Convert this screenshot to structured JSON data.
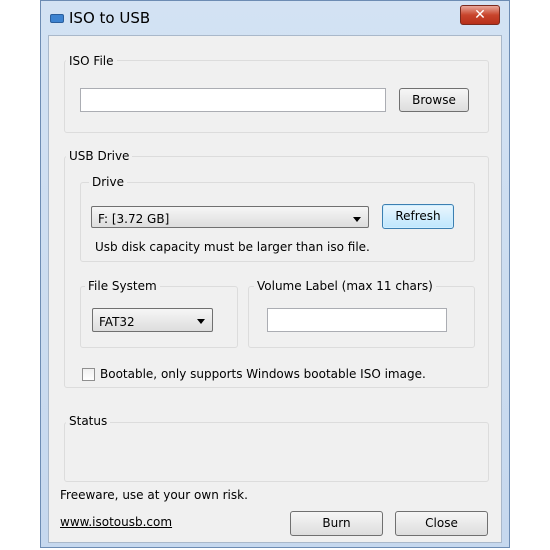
{
  "window": {
    "title": "ISO to USB",
    "close_glyph": "✕"
  },
  "iso_file": {
    "legend": "ISO File",
    "path_value": "",
    "browse_label": "Browse"
  },
  "usb_drive": {
    "legend": "USB Drive",
    "drive": {
      "legend": "Drive",
      "selected": "F: [3.72 GB]",
      "refresh_label": "Refresh",
      "hint": "Usb disk capacity must be larger than iso file."
    },
    "file_system": {
      "legend": "File System",
      "selected": "FAT32"
    },
    "volume_label": {
      "legend": "Volume Label (max 11 chars)",
      "value": ""
    },
    "bootable": {
      "label": "Bootable, only supports Windows bootable ISO image.",
      "checked": false
    }
  },
  "status": {
    "legend": "Status",
    "text": ""
  },
  "footer": {
    "disclaimer": "Freeware, use at your own risk.",
    "link": "www.isotousb.com",
    "burn_label": "Burn",
    "close_label": "Close"
  }
}
